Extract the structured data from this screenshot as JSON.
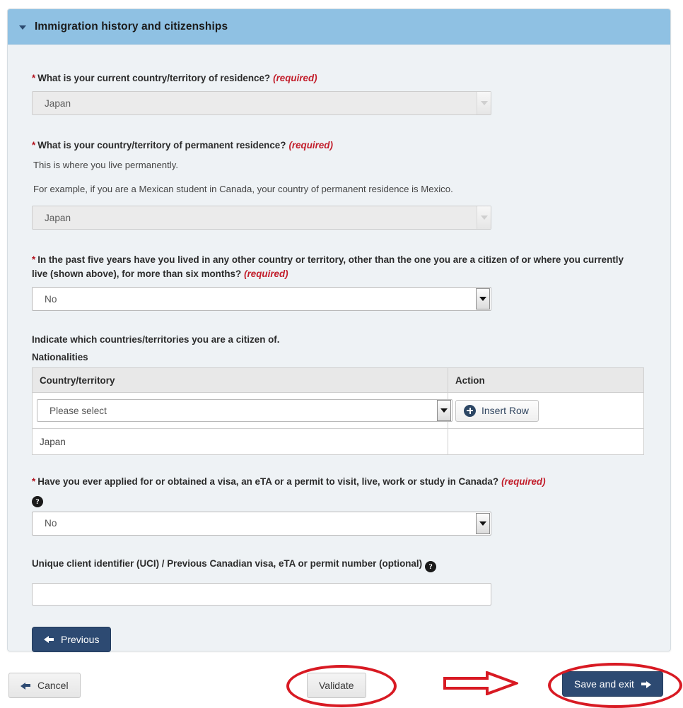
{
  "panel": {
    "title": "Immigration history and citizenships",
    "collapse_icon": "chevron-down-icon"
  },
  "form": {
    "required_marker": "*",
    "required_tag": "(required)",
    "current_residence": {
      "label": "What is your current country/territory of residence?",
      "value": "Japan"
    },
    "permanent_residence": {
      "label": "What is your country/territory of permanent residence?",
      "help_line_1": "This is where you live permanently.",
      "help_line_2": "For example, if you are a Mexican student in Canada, your country of permanent residence is Mexico.",
      "value": "Japan"
    },
    "lived_other_country": {
      "label": "In the past five years have you lived in any other country or territory, other than the one you are a citizen of or where you currently live (shown above), for more than six months?",
      "value": "No"
    },
    "nationalities": {
      "intro": "Indicate which countries/territories you are a citizen of.",
      "section_title": "Nationalities",
      "columns": [
        "Country/territory",
        "Action"
      ],
      "select_value": "Please select",
      "insert_row_label": "Insert Row",
      "insert_row_icon": "plus-circle-icon",
      "rows": [
        {
          "country": "Japan",
          "action": ""
        }
      ]
    },
    "visa_applied": {
      "label": "Have you ever applied for or obtained a visa, an eTA or a permit to visit, live, work or study in Canada?",
      "help_icon": "question-mark-icon",
      "value": "No"
    },
    "uci": {
      "label": "Unique client identifier (UCI) / Previous Canadian visa, eTA or permit number (optional)",
      "help_icon": "question-mark-icon",
      "value": "",
      "placeholder": ""
    },
    "previous_button": {
      "label": "Previous",
      "icon": "arrow-left-icon"
    }
  },
  "bottom_bar": {
    "cancel": {
      "label": "Cancel",
      "icon": "arrow-left-icon"
    },
    "validate": {
      "label": "Validate"
    },
    "save_and_exit": {
      "label": "Save and exit",
      "icon": "arrow-right-icon"
    }
  },
  "annotations": {
    "ellipse_validate": "red-ellipse-highlight",
    "ellipse_save_and_exit": "red-ellipse-highlight",
    "arrow": "red-arrow-right-annotation"
  },
  "colors": {
    "header_blue": "#8fc1e3",
    "panel_background": "#eef2f5",
    "primary_button": "#2d4a72",
    "required_red": "#c21e2b",
    "annotation_red": "#d81a23"
  }
}
